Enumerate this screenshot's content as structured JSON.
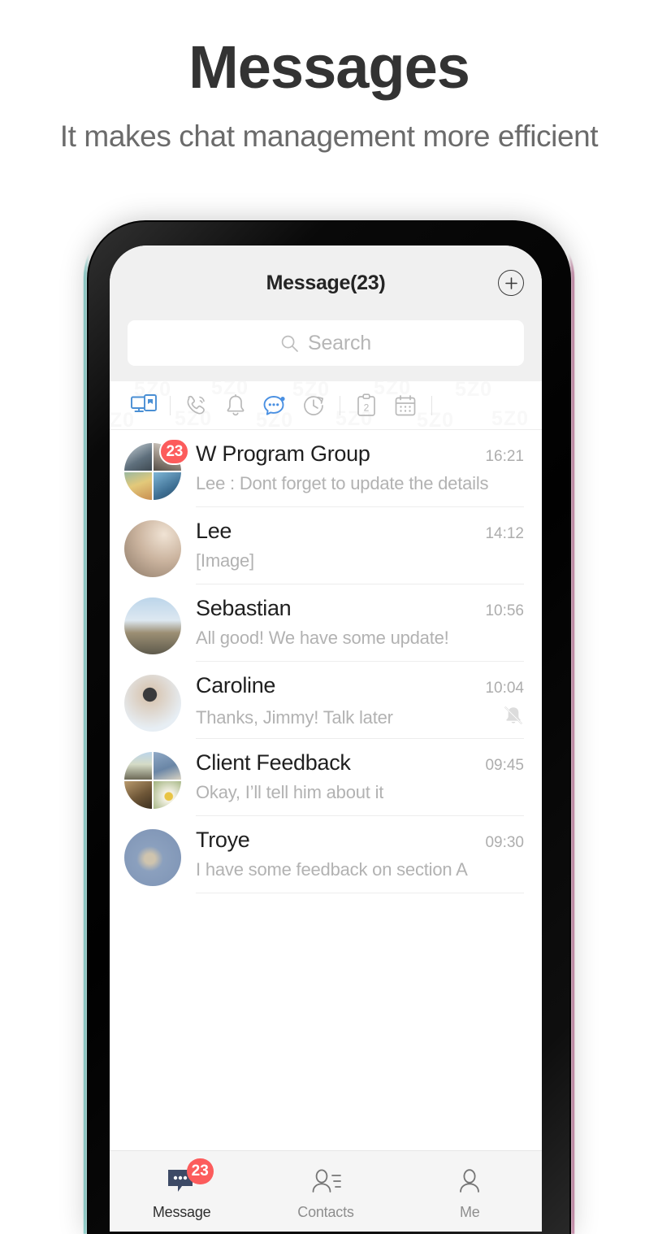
{
  "promo": {
    "title": "Messages",
    "subtitle": "It makes chat management more efficient"
  },
  "app": {
    "nav": {
      "title": "Message(23)",
      "add_button": "plus-icon"
    },
    "search": {
      "placeholder": "Search",
      "icon": "search-icon"
    },
    "watermark_text": "5Z0",
    "filters": [
      {
        "name": "devices-icon",
        "label": "Devices",
        "active": true
      },
      {
        "name": "divider",
        "label": "",
        "active": false
      },
      {
        "name": "phone-call-icon",
        "label": "Calls",
        "active": false
      },
      {
        "name": "bell-icon",
        "label": "Notifications",
        "active": false
      },
      {
        "name": "chat-bubble-icon",
        "label": "Chats",
        "active": true
      },
      {
        "name": "clock-history-icon",
        "label": "Recent",
        "active": false
      },
      {
        "name": "divider",
        "label": "",
        "active": false
      },
      {
        "name": "clipboard-icon",
        "label": "Tasks",
        "active": false,
        "count": "2"
      },
      {
        "name": "calendar-icon",
        "label": "Calendar",
        "active": false
      },
      {
        "name": "divider",
        "label": "",
        "active": false
      }
    ],
    "chats": [
      {
        "name": "W Program Group",
        "preview": "Lee : Dont forget to update the details",
        "time": "16:21",
        "badge": "23",
        "muted": false,
        "avatar_type": "quad",
        "avatar_tiles": [
          "#7e8fa0",
          "#b9b2a8",
          "#d7b98a",
          "#5e93b8"
        ]
      },
      {
        "name": "Lee",
        "preview": "[Image]",
        "time": "14:12",
        "badge": "",
        "muted": false,
        "avatar_type": "single",
        "avatar_tiles": [
          "#c8b5a4"
        ]
      },
      {
        "name": "Sebastian",
        "preview": "All good! We have some update!",
        "time": "10:56",
        "badge": "",
        "muted": false,
        "avatar_type": "single",
        "avatar_tiles": [
          "#9fb6cd"
        ]
      },
      {
        "name": "Caroline",
        "preview": "Thanks, Jimmy! Talk later",
        "time": "10:04",
        "badge": "",
        "muted": true,
        "avatar_type": "single",
        "avatar_tiles": [
          "#cfd8e0"
        ]
      },
      {
        "name": "Client Feedback",
        "preview": "Okay, I’ll  tell him about it",
        "time": "09:45",
        "badge": "",
        "muted": false,
        "avatar_type": "quad",
        "avatar_tiles": [
          "#b0bcc6",
          "#8ea6c2",
          "#a1835f",
          "#c9cfb4"
        ]
      },
      {
        "name": "Troye",
        "preview": "I have some feedback on section A",
        "time": "09:30",
        "badge": "",
        "muted": false,
        "avatar_type": "single",
        "avatar_tiles": [
          "#93a8c6"
        ]
      }
    ],
    "tabs": [
      {
        "label": "Message",
        "icon": "message-bubble-icon",
        "active": true,
        "badge": "23"
      },
      {
        "label": "Contacts",
        "icon": "contacts-icon",
        "active": false,
        "badge": ""
      },
      {
        "label": "Me",
        "icon": "person-icon",
        "active": false,
        "badge": ""
      }
    ]
  },
  "colors": {
    "accent_blue": "#4a90e2",
    "badge_red": "#fc5c5c",
    "tab_active": "#3d4a66",
    "header_bg": "#f0f0f0"
  }
}
